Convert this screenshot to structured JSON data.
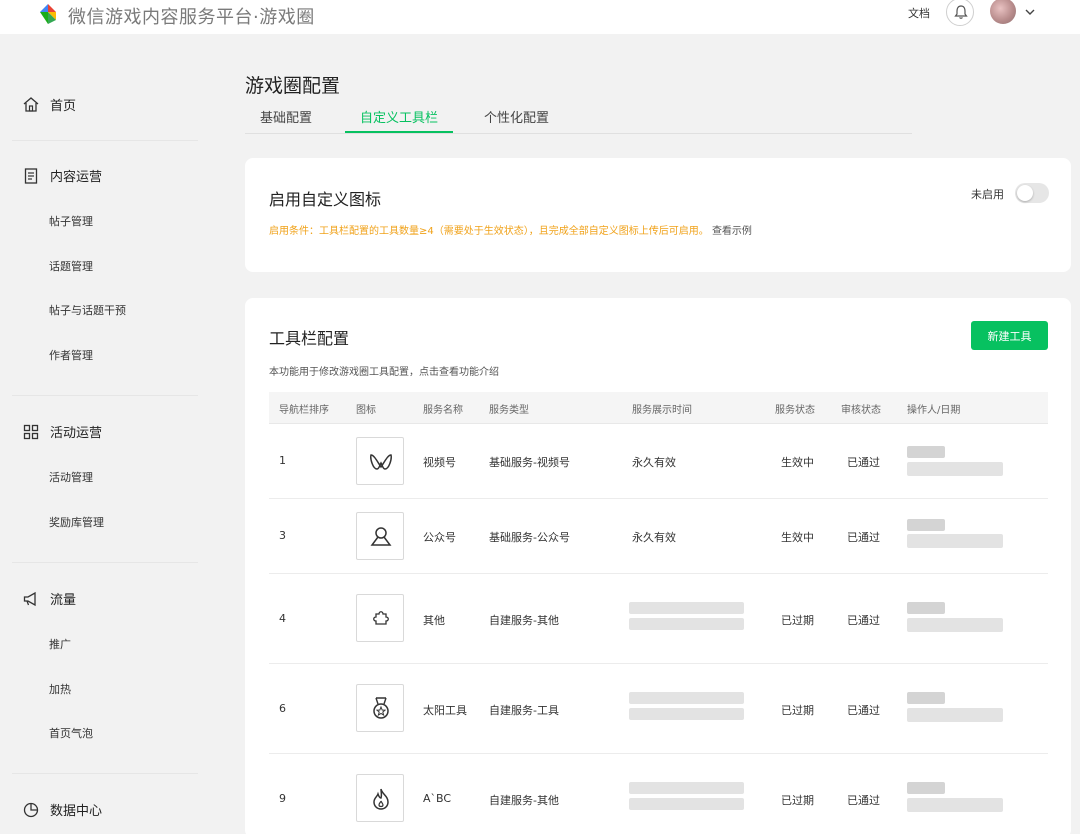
{
  "app": {
    "title": "微信游戏内容服务平台·游戏圈"
  },
  "header": {
    "doc_link": "文档"
  },
  "sidebar": {
    "groups": [
      {
        "label": "首页",
        "icon": "home-icon"
      },
      {
        "label": "内容运营",
        "icon": "document-icon",
        "items": [
          "帖子管理",
          "话题管理",
          "帖子与话题干预",
          "作者管理"
        ]
      },
      {
        "label": "活动运营",
        "icon": "grid-icon",
        "items": [
          "活动管理",
          "奖励库管理"
        ]
      },
      {
        "label": "流量",
        "icon": "megaphone-icon",
        "items": [
          "推广",
          "加热",
          "首页气泡"
        ]
      },
      {
        "label": "数据中心",
        "icon": "pie-chart-icon"
      }
    ]
  },
  "page": {
    "title": "游戏圈配置",
    "tabs": [
      "基础配置",
      "自定义工具栏",
      "个性化配置"
    ],
    "active_tab": "自定义工具栏"
  },
  "custom_icon": {
    "title": "启用自定义图标",
    "condition": "启用条件：工具栏配置的工具数量≥4（需要处于生效状态），且完成全部自定义图标上传后可启用。",
    "example_link": "查看示例",
    "switch_label": "未启用",
    "enabled": false
  },
  "toolbar": {
    "title": "工具栏配置",
    "new_button": "新建工具",
    "description": "本功能用于修改游戏圈工具配置，点击查看功能介绍",
    "columns": [
      "导航栏排序",
      "图标",
      "服务名称",
      "服务类型",
      "服务展示时间",
      "服务状态",
      "审核状态",
      "操作人/日期"
    ],
    "rows": [
      {
        "order": "1",
        "icon": "channels-icon",
        "name": "视频号",
        "type": "基础服务-视频号",
        "display_time": "永久有效",
        "status": "生效中",
        "review": "已通过"
      },
      {
        "order": "3",
        "icon": "official-account-icon",
        "name": "公众号",
        "type": "基础服务-公众号",
        "display_time": "永久有效",
        "status": "生效中",
        "review": "已通过"
      },
      {
        "order": "4",
        "icon": "puzzle-icon",
        "name": "其他",
        "type": "自建服务-其他",
        "display_time": "",
        "status": "已过期",
        "review": "已通过"
      },
      {
        "order": "6",
        "icon": "medal-icon",
        "name": "太阳工具",
        "type": "自建服务-工具",
        "display_time": "",
        "status": "已过期",
        "review": "已通过"
      },
      {
        "order": "9",
        "icon": "flame-icon",
        "name": "A`BC",
        "type": "自建服务-其他",
        "display_time": "",
        "status": "已过期",
        "review": "已通过"
      }
    ]
  },
  "colors": {
    "accent": "#07c160",
    "warning": "#f0a21a"
  }
}
